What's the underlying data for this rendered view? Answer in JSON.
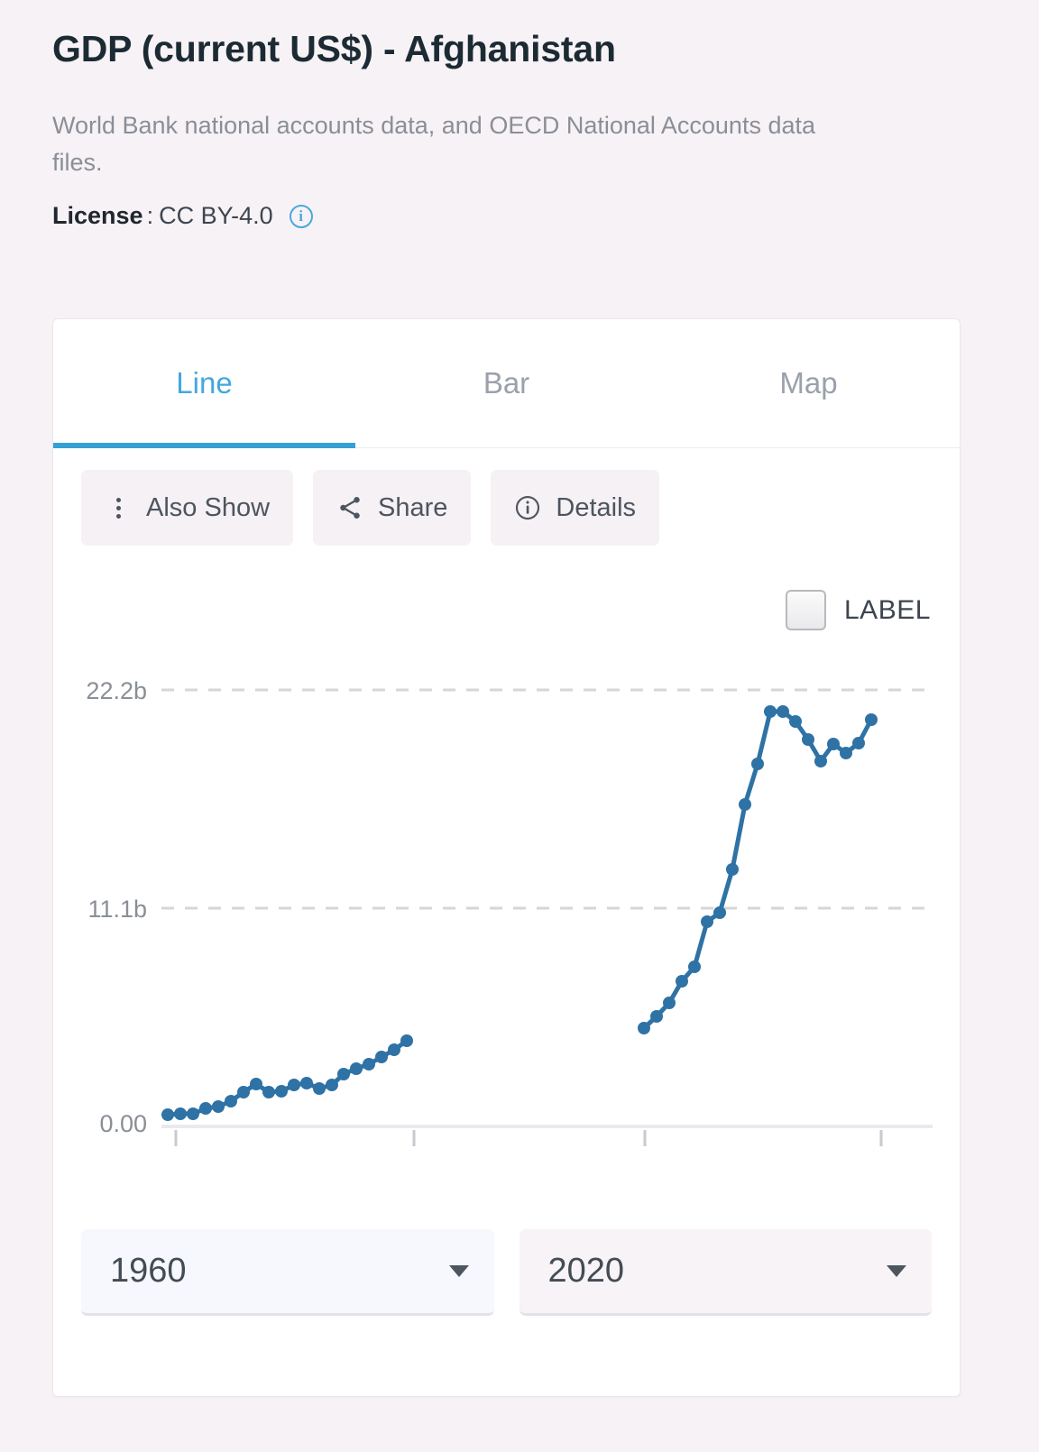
{
  "header": {
    "title": "GDP (current US$) - Afghanistan",
    "source": "World Bank national accounts data, and OECD National Accounts data files.",
    "license_label": "License",
    "license_separator": ":",
    "license_value": "CC BY-4.0",
    "info_glyph": "i"
  },
  "tabs": [
    {
      "label": "Line",
      "active": true
    },
    {
      "label": "Bar",
      "active": false
    },
    {
      "label": "Map",
      "active": false
    }
  ],
  "toolbar": {
    "also_show": "Also Show",
    "share": "Share",
    "details": "Details"
  },
  "chart_legend": {
    "label": "LABEL",
    "checked": false
  },
  "year_range": {
    "from": "1960",
    "to": "2020"
  },
  "colors": {
    "page_background": "#f7f2f6",
    "card_background": "#ffffff",
    "accent_blue": "#35a0d6",
    "tab_active_text": "#45a7dd",
    "series_blue": "#2f72a5",
    "gridline": "#d6d6d6",
    "muted_text": "#8a8f96",
    "info_icon": "#4aa8dd"
  },
  "chart_data": {
    "type": "line",
    "title": "GDP (current US$) - Afghanistan",
    "xlabel": "",
    "ylabel": "",
    "ylim": [
      0,
      22200000000
    ],
    "xlim": [
      1960,
      2020
    ],
    "grid": true,
    "gridlines_y": [
      0,
      11100000000,
      22200000000
    ],
    "ytick_labels": [
      "0.00",
      "11.1b",
      "22.2b"
    ],
    "ytick_values": [
      0,
      11100000000,
      22200000000
    ],
    "xtick_values": [
      1961,
      1981,
      2001,
      2021
    ],
    "xtick_labels": [
      "",
      "",
      "",
      ""
    ],
    "legend_position": "top-right",
    "marker": "circle",
    "line_style": "solid-with-gaps",
    "series": [
      {
        "name": "GDP (current US$) - Afghanistan",
        "color": "#2f72a5",
        "x": [
          1960,
          1961,
          1962,
          1963,
          1964,
          1965,
          1966,
          1967,
          1968,
          1969,
          1970,
          1971,
          1972,
          1973,
          1974,
          1975,
          1976,
          1977,
          1978,
          1979,
          2002,
          2003,
          2004,
          2005,
          2006,
          2007,
          2008,
          2009,
          2010,
          2011,
          2012,
          2013,
          2014,
          2015,
          2016,
          2017,
          2018,
          2019,
          2020
        ],
        "values": [
          0.54,
          0.55,
          0.55,
          0.75,
          0.8,
          1.01,
          1.4,
          1.67,
          1.37,
          1.41,
          1.75,
          1.83,
          1.6,
          1.73,
          2.16,
          2.37,
          2.56,
          2.9,
          3.24,
          3.7,
          4.37,
          4.98,
          5.7,
          6.81,
          7.53,
          9.84,
          10.3,
          12.49,
          15.86,
          17.89,
          20.54,
          20.56,
          20.05,
          19.13,
          18.02,
          18.88,
          18.42,
          18.9,
          20.14
        ],
        "units": "billions of current US$"
      }
    ],
    "data_gap_years": [
      1980,
      2001
    ],
    "notes": "Data unavailable 1980-2001 (visible gap in the line)."
  }
}
